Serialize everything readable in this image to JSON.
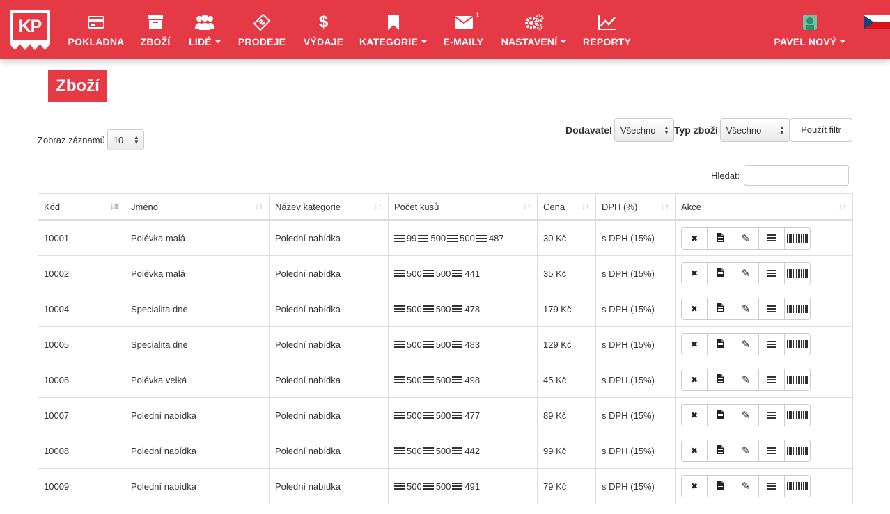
{
  "brand": {
    "logo_text": "KP",
    "accent": "#e63946"
  },
  "nav": [
    {
      "key": "pokladna",
      "label": "POKLADNA",
      "icon": "credit-card-icon",
      "dropdown": false
    },
    {
      "key": "zbozi",
      "label": "ZBOŽÍ",
      "icon": "archive-box-icon",
      "dropdown": false
    },
    {
      "key": "lide",
      "label": "LIDÉ",
      "icon": "users-icon",
      "dropdown": true
    },
    {
      "key": "prodeje",
      "label": "PRODEJE",
      "icon": "ticket-icon",
      "dropdown": false
    },
    {
      "key": "vydaje",
      "label": "VÝDAJE",
      "icon": "dollar-icon",
      "dropdown": false
    },
    {
      "key": "kategorie",
      "label": "KATEGORIE",
      "icon": "bookmark-icon",
      "dropdown": true
    },
    {
      "key": "emaily",
      "label": "E-MAILY",
      "icon": "envelope-icon",
      "dropdown": false,
      "badge": "1"
    },
    {
      "key": "nastaveni",
      "label": "NASTAVENÍ",
      "icon": "gears-icon",
      "dropdown": true
    },
    {
      "key": "reporty",
      "label": "REPORTY",
      "icon": "line-chart-icon",
      "dropdown": false
    }
  ],
  "user": {
    "name": "PAVEL NOVÝ",
    "icon": "user-avatar-icon"
  },
  "language": {
    "icon": "czech-flag-icon"
  },
  "page": {
    "title": "Zboží"
  },
  "length": {
    "label": "Zobraz záznamů",
    "value": "10"
  },
  "filters": {
    "supplier_label": "Dodavatel",
    "supplier_value": "Všechno",
    "type_label": "Typ zboží",
    "type_value": "Všechno",
    "apply_label": "Použít filtr"
  },
  "search": {
    "label": "Hledat:",
    "value": ""
  },
  "table": {
    "columns": [
      "Kód",
      "Jméno",
      "Název kategorie",
      "Počet kusů",
      "Cena",
      "DPH (%)",
      "Akce"
    ],
    "rows": [
      {
        "code": "10001",
        "name": "Polévka malá",
        "category": "Polední nabídka",
        "stock": [
          "99",
          "500",
          "500",
          "487"
        ],
        "price": "30 Kč",
        "vat": "s DPH (15%)"
      },
      {
        "code": "10002",
        "name": "Polévka malá",
        "category": "Polední nabídka",
        "stock": [
          "500",
          "500",
          "441"
        ],
        "price": "35 Kč",
        "vat": "s DPH (15%)"
      },
      {
        "code": "10004",
        "name": "Specialita dne",
        "category": "Polední nabídka",
        "stock": [
          "500",
          "500",
          "478"
        ],
        "price": "179 Kč",
        "vat": "s DPH (15%)"
      },
      {
        "code": "10005",
        "name": "Specialita dne",
        "category": "Polední nabídka",
        "stock": [
          "500",
          "500",
          "483"
        ],
        "price": "129 Kč",
        "vat": "s DPH (15%)"
      },
      {
        "code": "10006",
        "name": "Polévka velká",
        "category": "Polední nabídka",
        "stock": [
          "500",
          "500",
          "498"
        ],
        "price": "45 Kč",
        "vat": "s DPH (15%)"
      },
      {
        "code": "10007",
        "name": "Polední nabídka",
        "category": "Polední nabídka",
        "stock": [
          "500",
          "500",
          "477"
        ],
        "price": "89 Kč",
        "vat": "s DPH (15%)"
      },
      {
        "code": "10008",
        "name": "Polední nabídka",
        "category": "Polední nabídka",
        "stock": [
          "500",
          "500",
          "442"
        ],
        "price": "99 Kč",
        "vat": "s DPH (15%)"
      },
      {
        "code": "10009",
        "name": "Polední nabídka",
        "category": "Polední nabídka",
        "stock": [
          "500",
          "500",
          "491"
        ],
        "price": "79 Kč",
        "vat": "s DPH (15%)"
      }
    ],
    "actions": [
      "delete-icon",
      "document-icon",
      "edit-pencil-icon",
      "stock-list-icon",
      "barcode-icon"
    ]
  }
}
